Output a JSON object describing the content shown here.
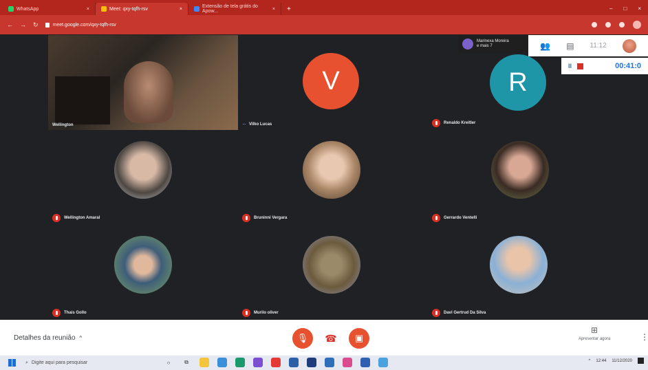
{
  "browser": {
    "tabs": [
      {
        "label": "WhatsApp",
        "favicon": "whatsapp-icon",
        "active": false
      },
      {
        "label": "Meet: qxy-tqfh-rsv",
        "favicon": "meet-icon",
        "active": true
      },
      {
        "label": "Extensão de tela grátis do Apow...",
        "favicon": "doc-icon",
        "active": false
      }
    ],
    "new_tab": "+",
    "url": "meet.google.com/qxy-tqfh-rsv",
    "window_controls": [
      "–",
      "□",
      "×"
    ]
  },
  "meet": {
    "host_badge": {
      "line1": "Marinexa Moreira",
      "line2": "e mais 7"
    },
    "clock": "11:12",
    "recording_timer": "00:41:0",
    "participants": [
      {
        "name": "Wellington",
        "type": "video",
        "speaking": false
      },
      {
        "name": "Vilko Lucas",
        "type": "initial",
        "initial": "V",
        "color": "#e8512f",
        "speaking": true
      },
      {
        "name": "Renaldo Kreitler",
        "type": "initial",
        "initial": "R",
        "color": "#1f95a8",
        "speaking": false
      },
      {
        "name": "Wellington Amaral",
        "type": "photo",
        "speaking": false
      },
      {
        "name": "Bruninni Vergara",
        "type": "photo",
        "speaking": false
      },
      {
        "name": "Gerrardo Ventelli",
        "type": "photo",
        "speaking": false
      },
      {
        "name": "Thais Gollo",
        "type": "photo",
        "speaking": false
      },
      {
        "name": "Murilo oliver",
        "type": "photo",
        "speaking": false
      },
      {
        "name": "Davi Gertrud Da Silva",
        "type": "photo",
        "speaking": false
      }
    ],
    "details_label": "Detalhes da reunião",
    "present_label": "Apresentar agora"
  },
  "taskbar": {
    "search_placeholder": "Digite aqui para pesquisar",
    "tray_time": "12:44",
    "tray_date": "11/12/2020"
  },
  "colors": {
    "tab_bar": "#b3261e",
    "meet_background": "#202124",
    "tile_background": "#3c4043",
    "accent_red": "#e8512f",
    "recording_blue": "#1a73e8"
  }
}
